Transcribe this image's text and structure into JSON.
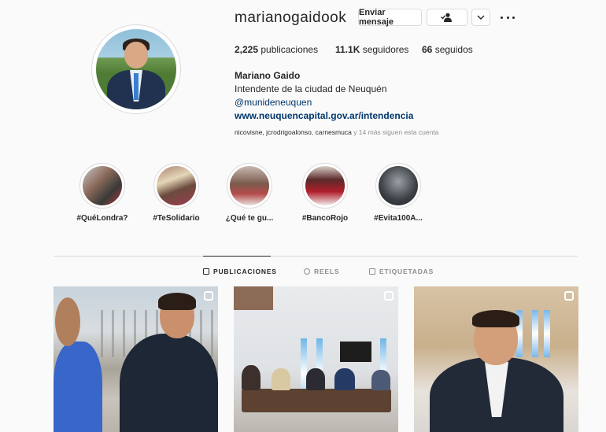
{
  "profile": {
    "username": "marianogaidook",
    "message_button": "Enviar mensaje",
    "follow_icon": "person-check-icon",
    "more_icon": "chevron-down-icon",
    "options_icon": "more-dots-icon"
  },
  "stats": {
    "posts_count": "2,225",
    "posts_label": "publicaciones",
    "followers_count": "11.1K",
    "followers_label": "seguidores",
    "following_count": "66",
    "following_label": "seguidos"
  },
  "bio": {
    "name": "Mariano Gaido",
    "description": "Intendente de la ciudad de Neuquén",
    "handle": "@munideneuquen",
    "link": "www.neuquencapital.gov.ar/intendencia"
  },
  "followed_by": {
    "names": "nicovisne, jcrodrigoalonso, carnesmuca",
    "suffix": " y 14 más siguen esta cuenta"
  },
  "highlights": [
    {
      "label": "#QuéLondra?"
    },
    {
      "label": "#TeSolidario"
    },
    {
      "label": "¿Qué te gu..."
    },
    {
      "label": "#BancoRojo"
    },
    {
      "label": "#Evita100A..."
    }
  ],
  "tabs": [
    {
      "label": "PUBLICACIONES",
      "icon": "grid-icon"
    },
    {
      "label": "REELS",
      "icon": "reels-icon"
    },
    {
      "label": "ETIQUETADAS",
      "icon": "tag-icon"
    }
  ],
  "colors": {
    "link": "#00376b",
    "text": "#262626",
    "muted": "#8e8e8e",
    "border": "#dbdbdb",
    "background": "#fafafa"
  }
}
